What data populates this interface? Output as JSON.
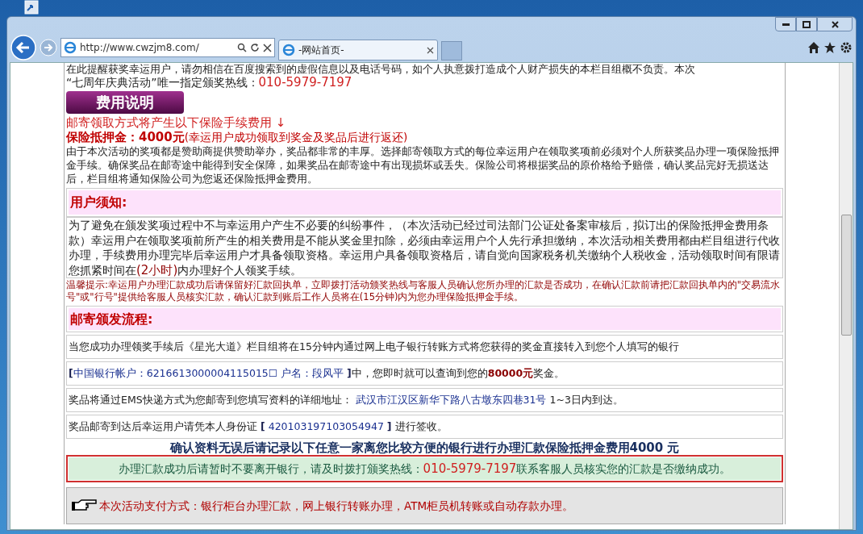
{
  "browser": {
    "address": "http://www.cwzjm8.com/",
    "tab_title": "-网站首页-"
  },
  "notice_top": {
    "text_1": "在此提醒获奖幸运用户，请勿相信在百度搜索到的虚假信息以及电话号码，如个人执意拨打造成个人财产损失的本栏目组概不负责。本次",
    "text_2": "“七周年庆典活动”唯一指定颁奖热线：",
    "hotline": "010-5979-7197"
  },
  "fee_button": "费用说明",
  "fee_intro": "邮寄领取方式将产生以下保险手续费用 ↓",
  "deposit": {
    "label": "保险抵押金：",
    "amount": "4000元",
    "note": "(幸运用户成功领取到奖金及奖品后进行返还)"
  },
  "fee_body": "由于本次活动的奖项都是赞助商提供赞助举办，奖品都非常的丰厚。选择邮寄领取方式的每位幸运用户在领取奖项前必须对个人所获奖品办理一项保险抵押金手续。确保奖品在邮寄途中能得到安全保障，如果奖品在邮寄途中有出现损坏或丢失。保险公司将根据奖品的原价格给予赔偿，确认奖品完好无损送达后，栏目组将通知保险公司为您返还保险抵押金费用。",
  "user_notice": {
    "heading": "用户须知:",
    "body_before": "为了避免在颁发奖项过程中不与幸运用户产生不必要的纠纷事件，（本次活动已经过司法部门公证处备案审核后，拟订出的保险抵押金费用条款）幸运用户在领取奖项前所产生的相关费用是不能从奖金里扣除，必须由幸运用户个人先行承担缴纳，本次活动相关费用都由栏目组进行代收办理，手续费用办理完毕后幸运用户才具备领取资格。幸运用户具备领取资格后，请自觉向国家税务机关缴纳个人税收金，活动领取时间有限请您抓紧时间在",
    "highlight": "(2小时)",
    "body_after": "内办理好个人领奖手续。"
  },
  "tip": "温馨提示:幸运用户办理汇款成功后请保留好汇款回执单，立即拨打活动颁奖热线与客服人员确认您所办理的汇款是否成功，在确认汇款前请把汇款回执单内的\"交易流水号\"或\"行号\"提供给客服人员核实汇款，确认汇款到账后工作人员将在(15分钟)内为您办理保险抵押金手续。",
  "flow": {
    "heading": "邮寄颁发流程:",
    "rows": [
      {
        "segments": [
          {
            "kind": "plain",
            "text": "当您成功办理领奖手续后《星光大道》栏目组将在15分钟内通过网上电子银行转账方式将您获得的奖金直接转入到您个人填写的银行"
          }
        ]
      },
      {
        "segments": [
          {
            "kind": "bracket",
            "text": "["
          },
          {
            "kind": "link",
            "text": "中国银行帐户：6216613000004115015☐ 户名：段风平 "
          },
          {
            "kind": "bracket",
            "text": "]"
          },
          {
            "kind": "plain",
            "text": "中，您即时就可以查询到您的"
          },
          {
            "kind": "amount",
            "text": "80000元"
          },
          {
            "kind": "plain",
            "text": "奖金。"
          }
        ]
      },
      {
        "segments": [
          {
            "kind": "plain",
            "text": "奖品将通过EMS快递方式为您邮寄到您填写资料的详细地址： "
          },
          {
            "kind": "link",
            "text": "武汉市江汉区新华下路八古墩东四巷31号"
          },
          {
            "kind": "plain",
            "text": " 1~3日内到达。"
          }
        ]
      },
      {
        "segments": [
          {
            "kind": "plain",
            "text": "奖品邮寄到达后幸运用户请凭本人身份证 "
          },
          {
            "kind": "bracket",
            "text": "["
          },
          {
            "kind": "link",
            "text": " 420103197103054947 "
          },
          {
            "kind": "bracket",
            "text": "]"
          },
          {
            "kind": "plain",
            "text": " 进行签收。"
          }
        ]
      }
    ]
  },
  "confirm": "确认资料无误后请记录以下任意一家离您比较方便的银行进行办理汇款保险抵押金费用4000 元",
  "green_box": {
    "before": "办理汇款成功后请暂时不要离开银行，请及时拨打颁奖热线：",
    "hotline": "010-5979-7197",
    "after": " 联系客服人员核实您的汇款是否缴纳成功。"
  },
  "payment": "本次活动支付方式：银行柜台办理汇款，网上银行转账办理，ATM柜员机转账或自动存款办理。"
}
